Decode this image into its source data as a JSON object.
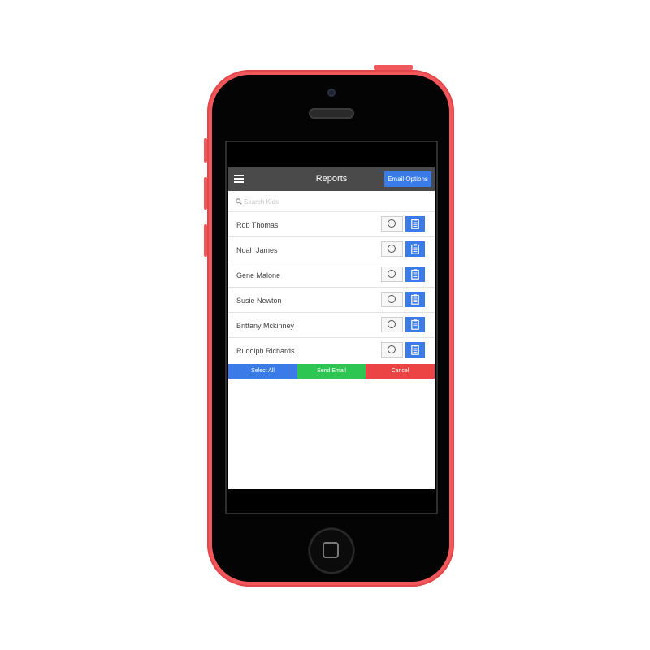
{
  "colors": {
    "phone": "#f2575b",
    "primary": "#3a7be8",
    "success": "#2dc653",
    "danger": "#ec4444",
    "header": "#4a4a4a"
  },
  "header": {
    "title": "Reports",
    "email_options_label": "Email Options",
    "menu_icon": "hamburger-icon"
  },
  "search": {
    "placeholder": "Search Kids",
    "value": ""
  },
  "kids": [
    {
      "name": "Rob Thomas"
    },
    {
      "name": "Noah James"
    },
    {
      "name": "Gene Malone"
    },
    {
      "name": "Susie Newton"
    },
    {
      "name": "Brittany Mckinney"
    },
    {
      "name": "Rudolph Richards"
    }
  ],
  "actions": {
    "select_all": "Select All",
    "send_email": "Send Email",
    "cancel": "Cancel"
  }
}
